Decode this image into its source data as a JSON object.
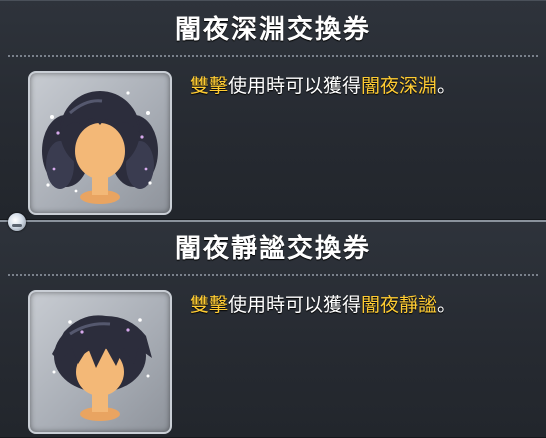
{
  "tooltips": [
    {
      "title": "闇夜深淵交換券",
      "description": {
        "prefix_highlight": "雙擊",
        "middle": "使用時可以獲得",
        "item_highlight": "闇夜深淵",
        "suffix": "。"
      },
      "icon": "hair-long-pigtails-icon"
    },
    {
      "title": "闇夜靜謐交換券",
      "description": {
        "prefix_highlight": "雙擊",
        "middle": "使用時可以獲得",
        "item_highlight": "闇夜靜謐",
        "suffix": "。"
      },
      "icon": "hair-short-icon"
    }
  ],
  "colors": {
    "highlight": "#ffcc33",
    "text": "#ffffff",
    "background": "#262a31",
    "hair": "#2c2d3c",
    "skin": "#f3b877"
  }
}
